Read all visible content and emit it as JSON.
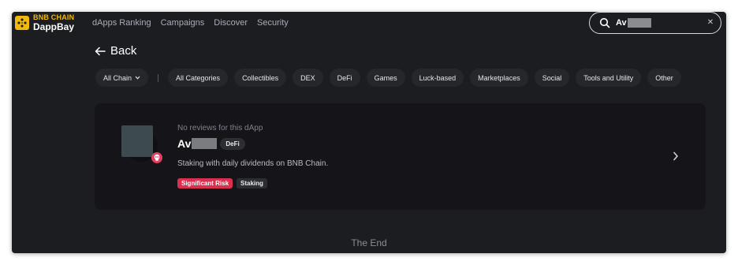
{
  "header": {
    "logo_top": "BNB CHAIN",
    "logo_bottom": "DappBay",
    "nav": [
      "dApps Ranking",
      "Campaigns",
      "Discover",
      "Security"
    ]
  },
  "search": {
    "value": "Av"
  },
  "back": {
    "label": "Back"
  },
  "filters": {
    "chain": "All Chain",
    "categories": [
      "All Categories",
      "Collectibles",
      "DEX",
      "DeFi",
      "Games",
      "Luck-based",
      "Marketplaces",
      "Social",
      "Tools and Utility",
      "Other"
    ]
  },
  "card": {
    "reviews": "No reviews for this dApp",
    "name": "Av",
    "category": "DeFi",
    "description": "Staking with daily dividends on BNB Chain.",
    "tags": {
      "risk": "Significant Risk",
      "type": "Staking"
    }
  },
  "footer": {
    "end": "The End"
  },
  "colors": {
    "brand": "#f0b90b",
    "risk": "#d9304f",
    "background": "#1c1d21",
    "card": "#151519"
  }
}
